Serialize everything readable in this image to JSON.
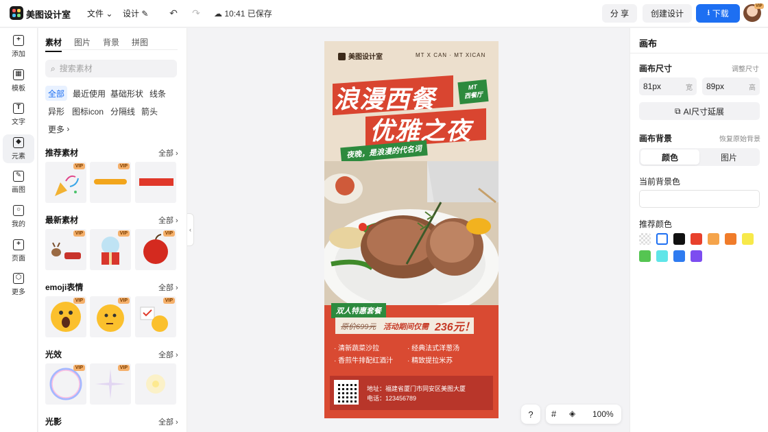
{
  "topbar": {
    "brand": "美图设计室",
    "file_menu": "文件",
    "design_menu": "设计",
    "saved_status": "10:41 已保存",
    "share": "分 享",
    "create": "创建设计",
    "download": "下载",
    "avatar_badge": "VIP"
  },
  "rail": [
    {
      "label": "添加",
      "icon": "plus-icon",
      "glyph": "+"
    },
    {
      "label": "模板",
      "icon": "template-icon",
      "glyph": "▦"
    },
    {
      "label": "文字",
      "icon": "text-icon",
      "glyph": "T"
    },
    {
      "label": "元素",
      "icon": "elements-icon",
      "glyph": "◆"
    },
    {
      "label": "画图",
      "icon": "draw-icon",
      "glyph": "✎"
    },
    {
      "label": "我的",
      "icon": "profile-icon",
      "glyph": "○"
    },
    {
      "label": "页面",
      "icon": "page-icon",
      "glyph": "+"
    },
    {
      "label": "更多",
      "icon": "more-icon",
      "glyph": "⬡"
    }
  ],
  "library": {
    "tabs": [
      "素材",
      "图片",
      "背景",
      "拼图"
    ],
    "search_placeholder": "搜索素材",
    "chips": [
      "全部",
      "最近使用",
      "基础形状",
      "线条",
      "异形",
      "图标icon",
      "分隔线",
      "箭头",
      "更多"
    ],
    "see_all": "全部",
    "vip": "VIP",
    "sections": [
      "推荐素材",
      "最新素材",
      "emoji表情",
      "光效",
      "光影"
    ]
  },
  "poster": {
    "logo": "美图设计室",
    "tagline": "MT X CAN · MT XICAN",
    "title_line1": "浪漫西餐",
    "title_line2": "优雅之夜",
    "badge_line1": "MT",
    "badge_line2": "西餐厅",
    "subtitle": "夜晚，是浪漫的代名词",
    "offer": "双人特惠套餐",
    "price_old": "原价699元",
    "price_text": "活动期间仅需",
    "price_new": "236元！",
    "menu": [
      "清新蔬菜沙拉",
      "经典法式洋葱汤",
      "香煎牛排配红酒汁",
      "精致提拉米苏"
    ],
    "address": "地址：福建省厦门市同安区美图大厦",
    "phone": "电话：123456789"
  },
  "canvas": {
    "help": "?",
    "zoom": "100%"
  },
  "right_panel": {
    "title": "画布",
    "size_label": "画布尺寸",
    "resize_link": "调整尺寸",
    "width_value": "81px",
    "width_unit": "宽",
    "height_value": "89px",
    "height_unit": "高",
    "ai_extend": "AI尺寸延展",
    "bg_label": "画布背景",
    "bg_reset": "恢复原始背景",
    "seg_color": "颜色",
    "seg_image": "图片",
    "current_bg": "当前背景色",
    "recommended": "推荐颜色",
    "swatches": [
      "#e8e8e8",
      "#ffffff",
      "#111111",
      "#e8412c",
      "#f5a44b",
      "#f07c2a",
      "#f7e94a",
      "#55c552",
      "#5fe5e8",
      "#2f7bf0",
      "#7c4df0"
    ]
  }
}
